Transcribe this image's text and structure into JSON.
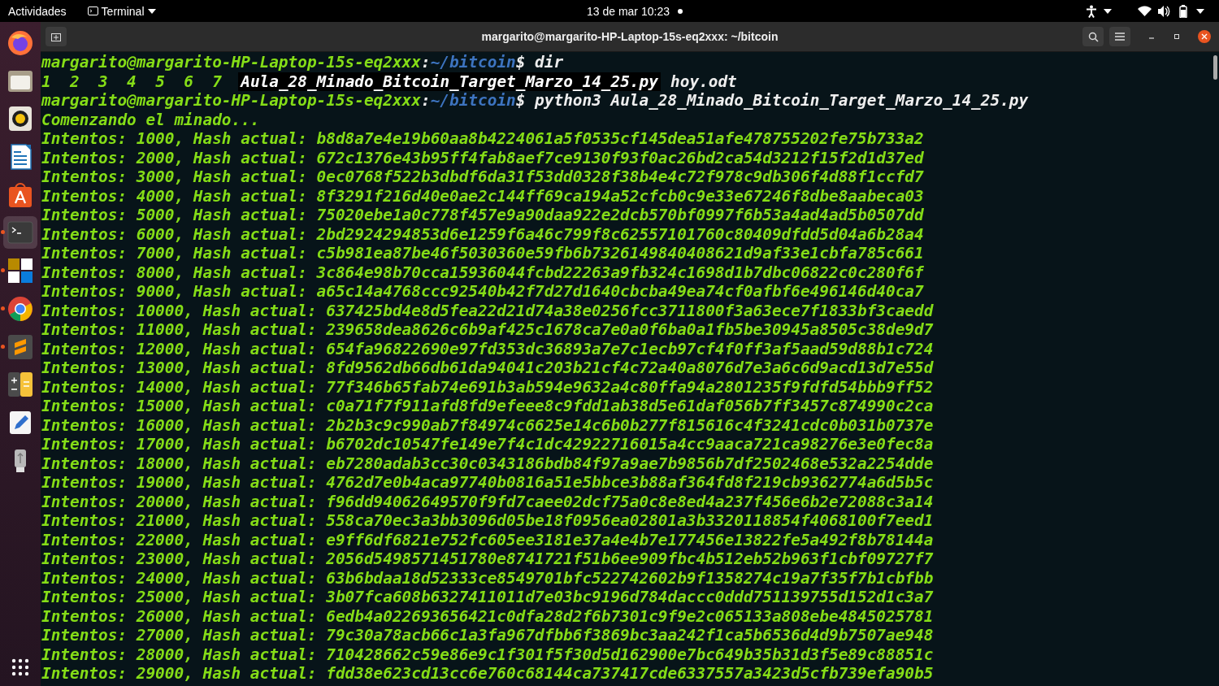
{
  "top_bar": {
    "activities": "Actividades",
    "app_menu": "Terminal",
    "clock": "13 de mar  10:23"
  },
  "dock": {
    "items": [
      {
        "kind": "firefox",
        "running": false,
        "selected": false
      },
      {
        "kind": "files",
        "running": false,
        "selected": false
      },
      {
        "kind": "music",
        "running": false,
        "selected": false
      },
      {
        "kind": "writer",
        "running": false,
        "selected": false
      },
      {
        "kind": "store",
        "running": false,
        "selected": false
      },
      {
        "kind": "terminal",
        "running": true,
        "selected": true
      },
      {
        "kind": "tiles",
        "running": true,
        "selected": false
      },
      {
        "kind": "chrome",
        "running": true,
        "selected": false
      },
      {
        "kind": "sublime",
        "running": true,
        "selected": false
      },
      {
        "kind": "calculator",
        "running": false,
        "selected": false
      },
      {
        "kind": "editor",
        "running": false,
        "selected": false
      },
      {
        "kind": "usb",
        "running": false,
        "selected": false
      }
    ]
  },
  "window": {
    "title": "margarito@margarito-HP-Laptop-15s-eq2xxx: ~/bitcoin"
  },
  "terminal": {
    "lines": [
      {
        "kind": "prompt",
        "user_host": "margarito@margarito-HP-Laptop-15s-eq2xxx",
        "separator": ":",
        "path": "~/bitcoin",
        "symbol": "$",
        "command": "dir"
      },
      {
        "kind": "listing",
        "entries": [
          {
            "text": "1",
            "kind": "dir"
          },
          {
            "text": "2",
            "kind": "dir"
          },
          {
            "text": "3",
            "kind": "dir"
          },
          {
            "text": "4",
            "kind": "dir"
          },
          {
            "text": "5",
            "kind": "dir"
          },
          {
            "text": "6",
            "kind": "dir"
          },
          {
            "text": "7",
            "kind": "dir"
          },
          {
            "text": "Aula_28_Minado_Bitcoin_Target_Marzo_14_25.py",
            "kind": "highlighted"
          },
          {
            "text": "hoy.odt",
            "kind": "file"
          }
        ]
      },
      {
        "kind": "prompt",
        "user_host": "margarito@margarito-HP-Laptop-15s-eq2xxx",
        "separator": ":",
        "path": "~/bitcoin",
        "symbol": "$",
        "command": "python3 Aula_28_Minado_Bitcoin_Target_Marzo_14_25.py"
      },
      {
        "kind": "output",
        "text": "Comenzando el minado..."
      },
      {
        "kind": "output",
        "text": "Intentos: 1000, Hash actual: b8d8a7e4e19b60aa8b4224061a5f0535cf145dea51afe478755202fe75b733a2"
      },
      {
        "kind": "output",
        "text": "Intentos: 2000, Hash actual: 672c1376e43b95ff4fab8aef7ce9130f93f0ac26bd2ca54d3212f15f2d1d37ed"
      },
      {
        "kind": "output",
        "text": "Intentos: 3000, Hash actual: 0ec0768f522b3dbdf6da31f53dd0328f38b4e4c72f978c9db306f4d88f1ccfd7"
      },
      {
        "kind": "output",
        "text": "Intentos: 4000, Hash actual: 8f3291f216d40e0ae2c144ff69ca194a52cfcb0c9e33e67246f8dbe8aabeca03"
      },
      {
        "kind": "output",
        "text": "Intentos: 5000, Hash actual: 75020ebe1a0c778f457e9a90daa922e2dcb570bf0997f6b53a4ad4ad5b0507dd"
      },
      {
        "kind": "output",
        "text": "Intentos: 6000, Hash actual: 2bd2924294853d6e1259f6a46c799f8c62557101760c80409dfdd5d04a6b28a4"
      },
      {
        "kind": "output",
        "text": "Intentos: 7000, Hash actual: c5b981ea87be46f5030360e59fb6b7326149840408621d9af33e1cbfa785c661"
      },
      {
        "kind": "output",
        "text": "Intentos: 8000, Hash actual: 3c864e98b70cca15936044fcbd22263a9fb324c1698d1b7dbc06822c0c280f6f"
      },
      {
        "kind": "output",
        "text": "Intentos: 9000, Hash actual: a65c14a4768ccc92540b42f7d27d1640cbcba49ea74cf0afbf6e496146d40ca7"
      },
      {
        "kind": "output",
        "text": "Intentos: 10000, Hash actual: 637425bd4e8d5fea22d21d74a38e0256fcc3711800f3a63ece7f1833bf3caedd"
      },
      {
        "kind": "output",
        "text": "Intentos: 11000, Hash actual: 239658dea8626c6b9af425c1678ca7e0a0f6ba0a1fb5be30945a8505c38de9d7"
      },
      {
        "kind": "output",
        "text": "Intentos: 12000, Hash actual: 654fa96822690e97fd353dc36893a7e7c1ecb97cf4f0ff3af5aad59d88b1c724"
      },
      {
        "kind": "output",
        "text": "Intentos: 13000, Hash actual: 8fd9562db66db61da94041c203b21cf4c72a40a8076d7e3a6c6d9acd13d7e55d"
      },
      {
        "kind": "output",
        "text": "Intentos: 14000, Hash actual: 77f346b65fab74e691b3ab594e9632a4c80ffa94a2801235f9fdfd54bbb9ff52"
      },
      {
        "kind": "output",
        "text": "Intentos: 15000, Hash actual: c0a71f7f911afd8fd9efeee8c9fdd1ab38d5e61daf056b7ff3457c874990c2ca"
      },
      {
        "kind": "output",
        "text": "Intentos: 16000, Hash actual: 2b2b3c9c990ab7f84974c6625e14c6b0b277f815616c4f3241cdc0b031b0737e"
      },
      {
        "kind": "output",
        "text": "Intentos: 17000, Hash actual: b6702dc10547fe149e7f4c1dc42922716015a4cc9aaca721ca98276e3e0fec8a"
      },
      {
        "kind": "output",
        "text": "Intentos: 18000, Hash actual: eb7280adab3cc30c0343186bdb84f97a9ae7b9856b7df2502468e532a2254dde"
      },
      {
        "kind": "output",
        "text": "Intentos: 19000, Hash actual: 4762d7e0b4aca97740b0816a51e5bbce3b88af364fd8f219cb9362774a6d5b5c"
      },
      {
        "kind": "output",
        "text": "Intentos: 20000, Hash actual: f96dd94062649570f9fd7caee02dcf75a0c8e8ed4a237f456e6b2e72088c3a14"
      },
      {
        "kind": "output",
        "text": "Intentos: 21000, Hash actual: 558ca70ec3a3bb3096d05be18f0956ea02801a3b3320118854f4068100f7eed1"
      },
      {
        "kind": "output",
        "text": "Intentos: 22000, Hash actual: e9ff6df6821e752fc605ee3181e37a4e4b7e177456e13822fe5a492f8b78144a"
      },
      {
        "kind": "output",
        "text": "Intentos: 23000, Hash actual: 2056d5498571451780e8741721f51b6ee909fbc4b512eb52b963f1cbf09727f7"
      },
      {
        "kind": "output",
        "text": "Intentos: 24000, Hash actual: 63b6bdaa18d52333ce8549701bfc522742602b9f1358274c19a7f35f7b1cbfbb"
      },
      {
        "kind": "output",
        "text": "Intentos: 25000, Hash actual: 3b07fca608b6327411011d7e03bc9196d784daccc0ddd751139755d152d1c3a7"
      },
      {
        "kind": "output",
        "text": "Intentos: 26000, Hash actual: 6edb4a022693656421c0dfa28d2f6b7301c9f9e2c065133a808ebe4845025781"
      },
      {
        "kind": "output",
        "text": "Intentos: 27000, Hash actual: 79c30a78acb66c1a3fa967dfbb6f3869bc3aa242f1ca5b6536d4d9b7507ae948"
      },
      {
        "kind": "output",
        "text": "Intentos: 28000, Hash actual: 710428662c59e86e9c1f301f5f30d5d162900e7bc649b35b31d3f5e89c88851c"
      },
      {
        "kind": "output",
        "text": "Intentos: 29000, Hash actual: fdd38e623cd13cc6e760c68144ca737417cde6337557a3423d5cfb739efa90b5"
      }
    ]
  }
}
